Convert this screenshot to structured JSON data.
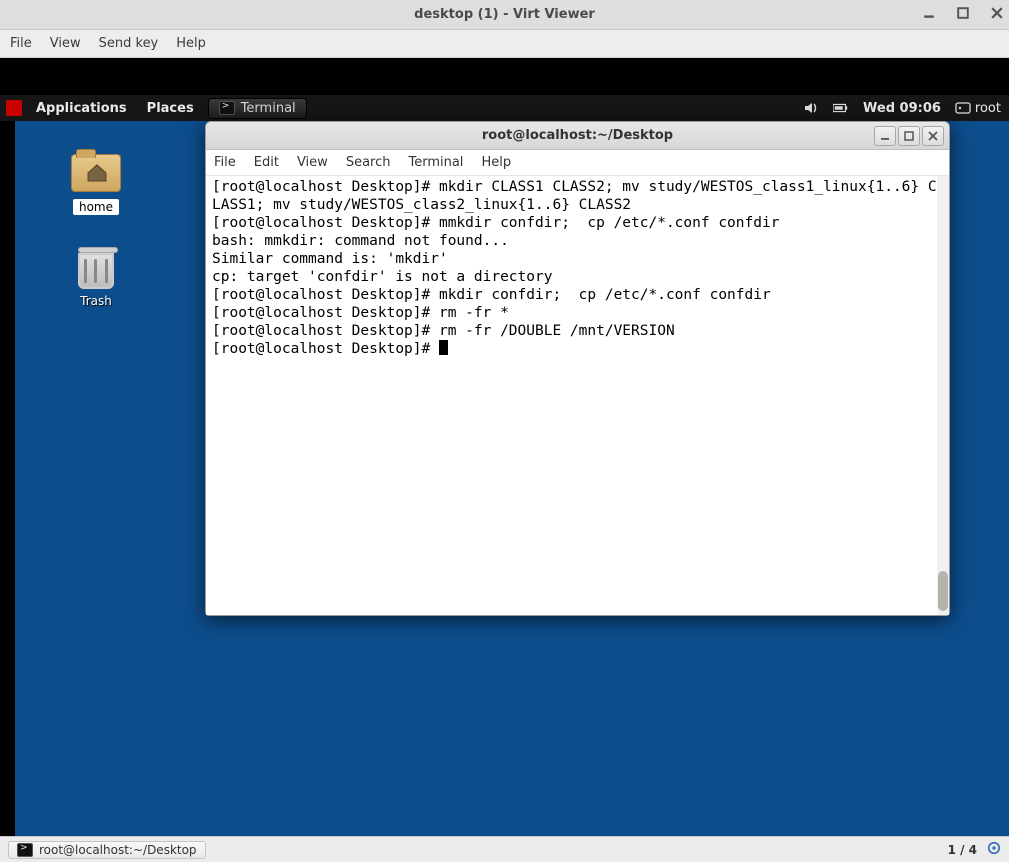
{
  "virtviewer": {
    "title": "desktop (1) - Virt Viewer",
    "menu": {
      "file": "File",
      "view": "View",
      "sendkey": "Send key",
      "help": "Help"
    }
  },
  "vm_topbar": {
    "applications": "Applications",
    "places": "Places",
    "active_task": "Terminal",
    "clock": "Wed 09:06",
    "user": "root"
  },
  "desktop": {
    "home_label": "home",
    "trash_label": "Trash"
  },
  "terminal_window": {
    "title": "root@localhost:~/Desktop",
    "menu": {
      "file": "File",
      "edit": "Edit",
      "view": "View",
      "search": "Search",
      "terminal": "Terminal",
      "help": "Help"
    },
    "prompt": "[root@localhost Desktop]# ",
    "lines": [
      "[root@localhost Desktop]# mkdir CLASS1 CLASS2; mv study/WESTOS_class1_linux{1..6} CLASS1; mv study/WESTOS_class2_linux{1..6} CLASS2",
      "[root@localhost Desktop]# mmkdir confdir;  cp /etc/*.conf confdir",
      "bash: mmkdir: command not found...",
      "Similar command is: 'mkdir'",
      "cp: target 'confdir' is not a directory",
      "[root@localhost Desktop]# mkdir confdir;  cp /etc/*.conf confdir",
      "[root@localhost Desktop]# rm -fr *",
      "[root@localhost Desktop]# rm -fr /DOUBLE /mnt/VERSION"
    ]
  },
  "host_panel": {
    "task": "root@localhost:~/Desktop",
    "workspace": "1 / 4"
  }
}
